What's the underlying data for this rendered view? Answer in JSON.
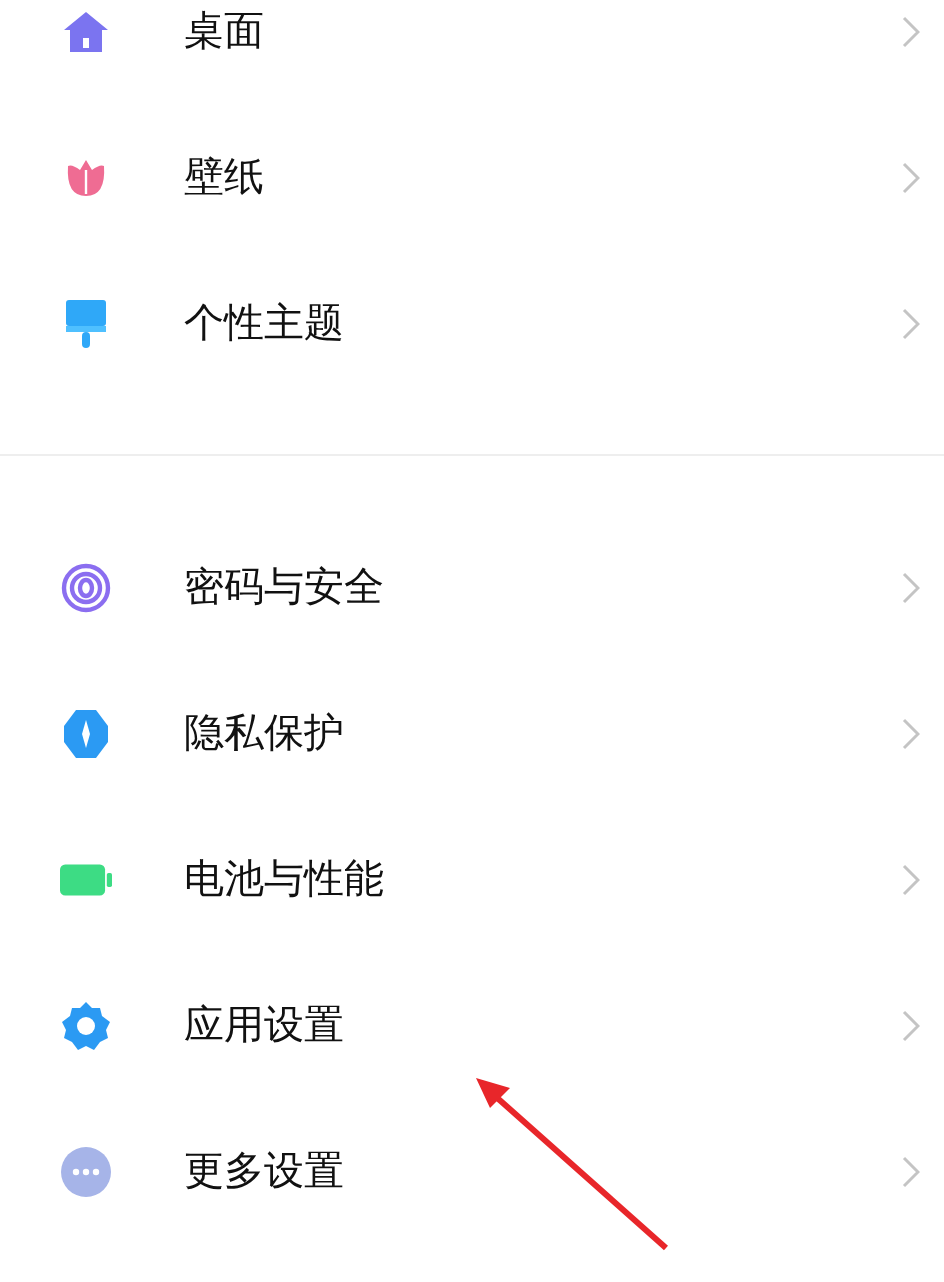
{
  "groups": [
    {
      "items": [
        {
          "label": "桌面"
        },
        {
          "label": "壁纸"
        },
        {
          "label": "个性主题"
        }
      ]
    },
    {
      "items": [
        {
          "label": "密码与安全"
        },
        {
          "label": "隐私保护"
        },
        {
          "label": "电池与性能"
        },
        {
          "label": "应用设置"
        },
        {
          "label": "更多设置"
        }
      ]
    }
  ],
  "annotations": [
    {
      "kind": "arrow"
    }
  ]
}
